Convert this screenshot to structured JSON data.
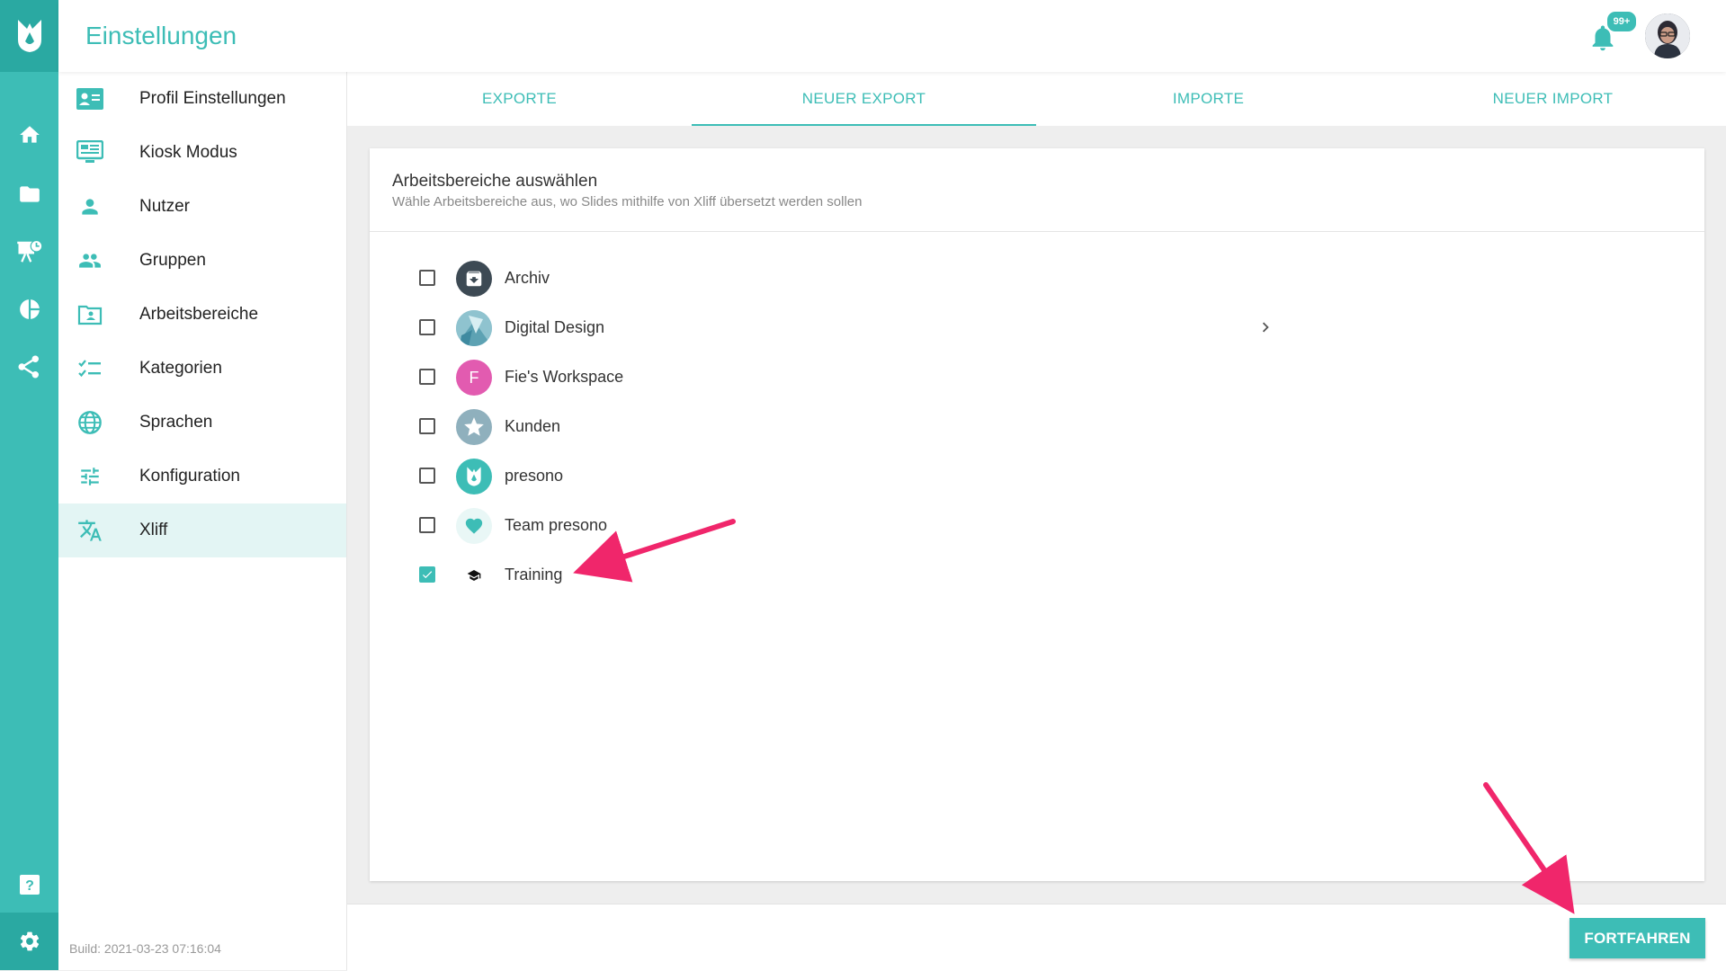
{
  "header": {
    "title": "Einstellungen",
    "notification_badge": "99+"
  },
  "rail": {
    "items": [
      {
        "icon": "home-icon"
      },
      {
        "icon": "folder-icon"
      },
      {
        "icon": "presentation-icon"
      },
      {
        "icon": "pie-chart-icon"
      },
      {
        "icon": "share-icon"
      },
      {
        "icon": "help-icon"
      },
      {
        "icon": "gear-icon"
      }
    ]
  },
  "nav": {
    "items": [
      {
        "label": "Profil Einstellungen",
        "icon": "profile-card-icon"
      },
      {
        "label": "Kiosk Modus",
        "icon": "monitor-icon"
      },
      {
        "label": "Nutzer",
        "icon": "person-icon"
      },
      {
        "label": "Gruppen",
        "icon": "group-icon"
      },
      {
        "label": "Arbeitsbereiche",
        "icon": "workspace-folder-icon"
      },
      {
        "label": "Kategorien",
        "icon": "checklist-icon"
      },
      {
        "label": "Sprachen",
        "icon": "globe-icon"
      },
      {
        "label": "Konfiguration",
        "icon": "sliders-icon"
      },
      {
        "label": "Xliff",
        "icon": "translate-icon",
        "active": true
      }
    ],
    "build": "Build: 2021-03-23 07:16:04"
  },
  "tabs": [
    {
      "label": "EXPORTE"
    },
    {
      "label": "NEUER EXPORT",
      "active": true
    },
    {
      "label": "IMPORTE"
    },
    {
      "label": "NEUER IMPORT"
    }
  ],
  "card": {
    "title": "Arbeitsbereiche auswählen",
    "subtitle": "Wähle Arbeitsbereiche aus, wo Slides mithilfe von Xliff übersetzt werden sollen",
    "workspaces": [
      {
        "label": "Archiv",
        "checked": false,
        "icon": "archive-icon",
        "color": "#3d4a54"
      },
      {
        "label": "Digital Design",
        "checked": false,
        "icon": "design-icon",
        "color": "#7fb6c4",
        "has_children": true
      },
      {
        "label": "Fie's Workspace",
        "checked": false,
        "icon": "letter-f-icon",
        "color": "#e25bb0",
        "letter": "F"
      },
      {
        "label": "Kunden",
        "checked": false,
        "icon": "star-icon",
        "color": "#8fb0bd"
      },
      {
        "label": "presono",
        "checked": false,
        "icon": "presono-logo-icon",
        "color": "#3dbdb6"
      },
      {
        "label": "Team presono",
        "checked": false,
        "icon": "heart-icon",
        "color": "#e9f7f6"
      },
      {
        "label": "Training",
        "checked": true,
        "icon": "graduation-cap-icon",
        "color": "#ffffff"
      }
    ]
  },
  "footer": {
    "continue_label": "FORTFAHREN"
  },
  "colors": {
    "accent": "#3dbdb6",
    "accent_dark": "#2aa9a2",
    "annotation": "#f0266b"
  }
}
